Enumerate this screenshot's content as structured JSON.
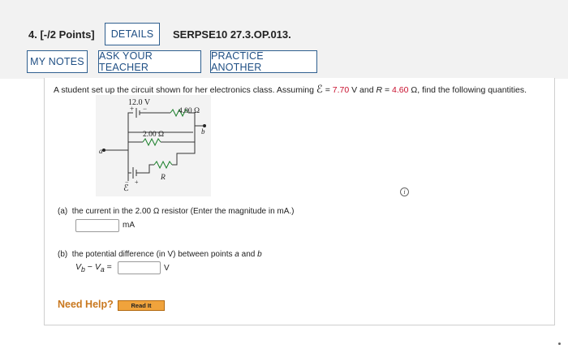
{
  "question": {
    "number": "4.",
    "points": "[-/2 Points]",
    "code": "SERPSE10 27.3.OP.013."
  },
  "buttons": {
    "details": "DETAILS",
    "my_notes": "MY NOTES",
    "ask_teacher": "ASK YOUR TEACHER",
    "practice": "PRACTICE ANOTHER"
  },
  "prompt": {
    "before": "A student set up the circuit shown for her electronics class. Assuming ",
    "emf_symbol": "ℰ",
    "eq1": " = ",
    "emf_value": "7.70",
    "mid": " V and ",
    "r_symbol": "R",
    "eq2": " = ",
    "r_value": "4.60",
    "after": " Ω, find the following quantities."
  },
  "circuit": {
    "battery_label": "12.0 V",
    "plus": "+",
    "minus": "−",
    "r1": "4.00 Ω",
    "r2": "2.00 Ω",
    "r_label": "R",
    "emf": "ℰ",
    "point_a": "a",
    "point_b": "b",
    "emf_minus": "−",
    "emf_plus": "+"
  },
  "info_icon": "i",
  "part_a": {
    "label": "(a)",
    "text": "the current in the 2.00 Ω resistor (Enter the magnitude in mA.)",
    "unit": "mA",
    "value": ""
  },
  "part_b": {
    "label": "(b)",
    "text_before": "the potential difference (in V) between points ",
    "point_a": "a",
    "text_and": " and ",
    "point_b": "b",
    "vb": "V",
    "vb_sub": "b",
    "minus": " − ",
    "va": "V",
    "va_sub": "a",
    "eq": " =",
    "unit": "V",
    "value": ""
  },
  "help": {
    "label": "Need Help?",
    "read_it": "Read It"
  }
}
